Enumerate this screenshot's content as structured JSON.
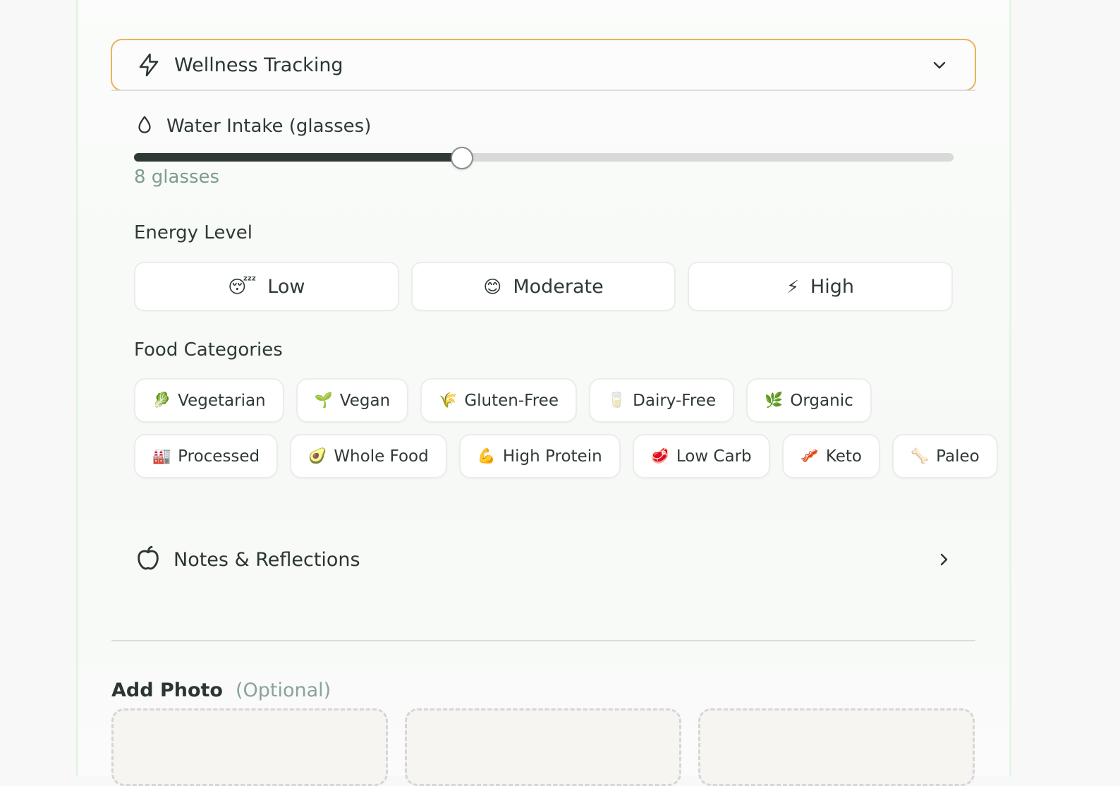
{
  "wellness": {
    "title": "Wellness Tracking",
    "header_icon": "lightning-icon",
    "expand_icon": "chevron-down-icon",
    "water": {
      "icon": "water-drop-icon",
      "label": "Water Intake (glasses)",
      "value": 8,
      "max": 20,
      "value_text": "8 glasses"
    },
    "energy": {
      "label": "Energy Level",
      "options": [
        {
          "emoji": "😴",
          "label": "Low"
        },
        {
          "emoji": "😊",
          "label": "Moderate"
        },
        {
          "emoji": "⚡",
          "label": "High"
        }
      ]
    },
    "food": {
      "label": "Food Categories",
      "row1": [
        {
          "emoji": "🥬",
          "label": "Vegetarian"
        },
        {
          "emoji": "🌱",
          "label": "Vegan"
        },
        {
          "emoji": "🌾",
          "label": "Gluten-Free"
        },
        {
          "emoji": "🥛",
          "label": "Dairy-Free"
        },
        {
          "emoji": "🌿",
          "label": "Organic"
        }
      ],
      "row2": [
        {
          "emoji": "🏭",
          "label": "Processed"
        },
        {
          "emoji": "🥑",
          "label": "Whole Food"
        },
        {
          "emoji": "💪",
          "label": "High Protein"
        },
        {
          "emoji": "🥩",
          "label": "Low Carb"
        },
        {
          "emoji": "🥓",
          "label": "Keto"
        },
        {
          "emoji": "🦴",
          "label": "Paleo"
        }
      ]
    }
  },
  "notes": {
    "icon": "apple-icon",
    "title": "Notes & Reflections",
    "expand_icon": "chevron-right-icon"
  },
  "photo": {
    "label": "Add Photo",
    "optional": "(Optional)"
  },
  "colors": {
    "accent_border": "#e9b35a",
    "slider_fill": "#2f3a36",
    "muted_text": "#7d9c91"
  }
}
